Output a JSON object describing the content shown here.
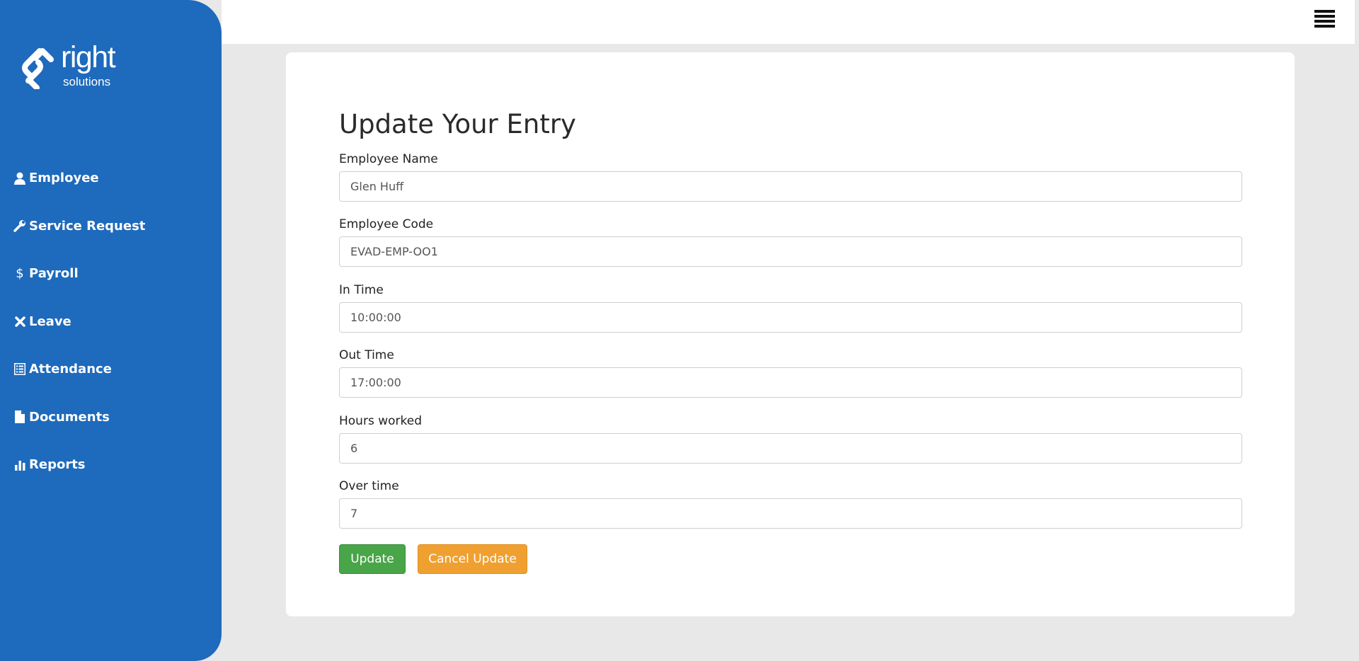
{
  "brand": {
    "name": "right",
    "tagline": "solutions",
    "logo_icon": "right-solutions-logo-icon"
  },
  "colors": {
    "sidebar": "#1e6abc",
    "update_button": "#48a548",
    "cancel_button": "#f0a030"
  },
  "sidebar": {
    "items": [
      {
        "label": "Employee",
        "icon": "user-icon"
      },
      {
        "label": "Service Request",
        "icon": "wrench-icon"
      },
      {
        "label": "Payroll",
        "icon": "dollar-icon"
      },
      {
        "label": "Leave",
        "icon": "x-mark-icon"
      },
      {
        "label": "Attendance",
        "icon": "list-icon"
      },
      {
        "label": "Documents",
        "icon": "document-icon"
      },
      {
        "label": "Reports",
        "icon": "bar-chart-icon"
      }
    ]
  },
  "topbar": {
    "menu_icon": "hamburger-menu-icon"
  },
  "form": {
    "title": "Update Your Entry",
    "fields": [
      {
        "label": "Employee Name",
        "value": "Glen Huff"
      },
      {
        "label": "Employee Code",
        "value": "EVAD-EMP-OO1"
      },
      {
        "label": "In Time",
        "value": "10:00:00"
      },
      {
        "label": "Out Time",
        "value": "17:00:00"
      },
      {
        "label": "Hours worked",
        "value": "6"
      },
      {
        "label": "Over time",
        "value": "7"
      }
    ],
    "update_label": "Update",
    "cancel_label": "Cancel Update"
  }
}
